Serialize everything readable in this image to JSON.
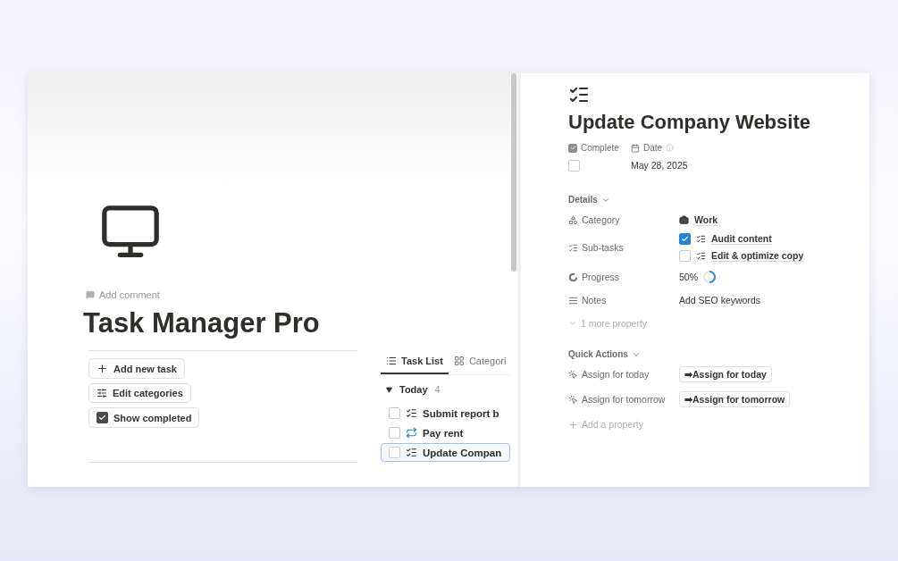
{
  "left": {
    "add_comment": "Add comment",
    "title": "Task Manager Pro",
    "buttons": [
      {
        "kind": "add",
        "label": "Add new task"
      },
      {
        "kind": "settings",
        "label": "Edit categories"
      },
      {
        "kind": "checkbox",
        "label": "Show completed",
        "checked": true
      }
    ],
    "tabs": [
      {
        "kind": "list",
        "label": "Task List",
        "selected": true
      },
      {
        "kind": "grid",
        "label": "Categori",
        "selected": false
      }
    ],
    "group": {
      "label": "Today",
      "count": "4",
      "expanded": true
    },
    "tasks": [
      {
        "kind": "checklist",
        "title": "Submit report b",
        "checked": false,
        "selected": false
      },
      {
        "kind": "repeat",
        "title": "Pay rent",
        "checked": false,
        "selected": false
      },
      {
        "kind": "checklist",
        "title": "Update Compan",
        "checked": false,
        "selected": true
      }
    ]
  },
  "detail": {
    "title": "Update Company Website",
    "complete": {
      "label": "Complete",
      "checked": false
    },
    "date": {
      "label": "Date",
      "value": "May 28, 2025"
    },
    "details": {
      "label": "Details",
      "expanded": true
    },
    "properties": [
      {
        "kind": "category",
        "label": "Category",
        "value": "Work"
      },
      {
        "kind": "subtasks",
        "label": "Sub-tasks",
        "items": [
          {
            "label": "Audit content",
            "checked": true
          },
          {
            "label": "Edit & optimize copy",
            "checked": false
          }
        ]
      },
      {
        "kind": "progress",
        "label": "Progress",
        "value": "50%",
        "level": 0.5
      },
      {
        "kind": "notes",
        "label": "Notes",
        "value": "Add SEO keywords"
      }
    ],
    "more": "1 more property",
    "quick_actions": {
      "label": "Quick Actions",
      "expanded": true,
      "rows": [
        {
          "label": "Assign for today",
          "button": "➡Assign for today"
        },
        {
          "label": "Assign for tomorrow",
          "button": "➡Assign for tomorrow"
        }
      ]
    },
    "add_property": "Add a property"
  }
}
